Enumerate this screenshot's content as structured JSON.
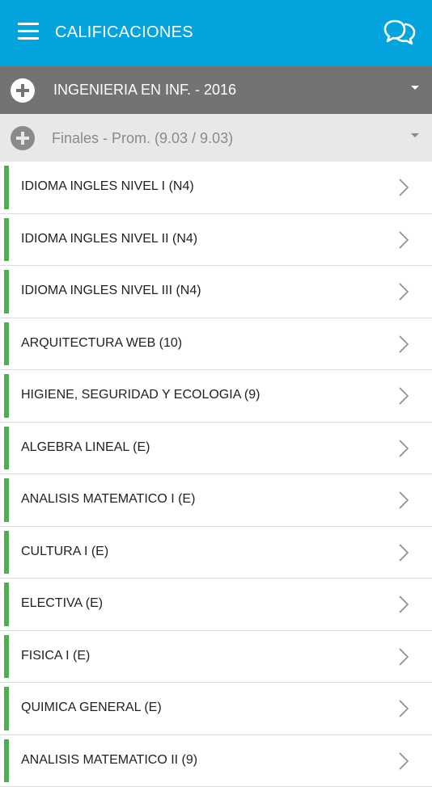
{
  "appbar": {
    "title": "CALIFICACIONES",
    "menu_icon": "hamburger-menu-icon",
    "chat_icon": "chat-bubbles-icon",
    "color": "#03a3de"
  },
  "career": {
    "label": "INGENIERIA EN INF. - 2016",
    "expand_icon": "plus-circle-icon",
    "dropdown_icon": "caret-down-icon"
  },
  "finals": {
    "label": "Finales - Prom. (9.03 / 9.03)",
    "expand_icon": "plus-circle-icon",
    "dropdown_icon": "caret-down-icon"
  },
  "subjects": [
    {
      "name": "IDIOMA INGLES NIVEL I (N4)"
    },
    {
      "name": "IDIOMA INGLES NIVEL II (N4)"
    },
    {
      "name": "IDIOMA INGLES NIVEL III (N4)"
    },
    {
      "name": "ARQUITECTURA WEB (10)"
    },
    {
      "name": "HIGIENE, SEGURIDAD Y ECOLOGIA (9)"
    },
    {
      "name": "ALGEBRA LINEAL (E)"
    },
    {
      "name": "ANALISIS MATEMATICO I (E)"
    },
    {
      "name": "CULTURA I (E)"
    },
    {
      "name": "ELECTIVA (E)"
    },
    {
      "name": "FISICA I (E)"
    },
    {
      "name": "QUIMICA GENERAL (E)"
    },
    {
      "name": "ANALISIS MATEMATICO II (9)"
    }
  ],
  "colors": {
    "accent_green": "#4caf50",
    "section_gray": "#737373",
    "subheader_gray": "#e8e8e8"
  }
}
